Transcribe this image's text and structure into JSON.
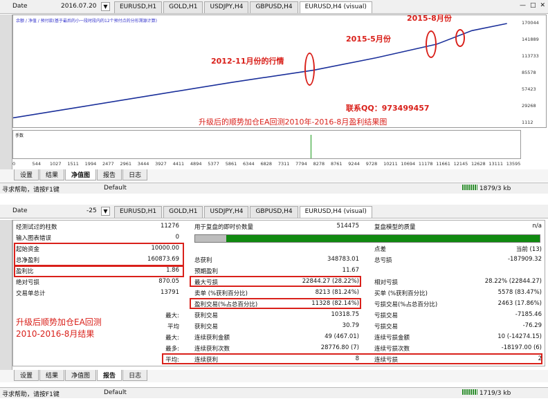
{
  "top": {
    "date_label": "Date",
    "date_value": "2016.07.20",
    "dropdown_glyph": "▼",
    "tabs": [
      "EURUSD,H1",
      "GOLD,H1",
      "USDJPY,H4",
      "GBPUSD,H4",
      "EURUSD,H4 (visual)"
    ],
    "active_tab": 4,
    "win_min": "—",
    "win_max": "□",
    "win_close": "✕"
  },
  "chart": {
    "legend": "余额 / 净值 / 预付款(基于最后的小一段时段内的12个预付点的分形溯源计算)",
    "sub_label": "手数",
    "y_ticks": [
      "170044",
      "141889",
      "113733",
      "85578",
      "57423",
      "29268",
      "1112"
    ],
    "x_ticks": [
      "0",
      "544",
      "1027",
      "1511",
      "1994",
      "2477",
      "2961",
      "3444",
      "3927",
      "4411",
      "4894",
      "5377",
      "5861",
      "6344",
      "6828",
      "7311",
      "7794",
      "8278",
      "8761",
      "9244",
      "9728",
      "10211",
      "10694",
      "11178",
      "11661",
      "12145",
      "12628",
      "13111",
      "13595"
    ],
    "annotations": {
      "a2012": "2012-11月份的行情",
      "a2015_5": "2015-5月份",
      "a2015_8": "2015-8月份",
      "qq": "联系QQ：973499457",
      "caption": "升级后的顺势加仓EA回测2010年-2016-8月盈利结果图"
    },
    "line_color": "#1a2f9a",
    "chart_data": {
      "type": "line",
      "x": [
        0,
        2000,
        4000,
        6000,
        8278,
        10000,
        11661,
        12628,
        13595
      ],
      "series": [
        {
          "values": [
            10000,
            30000,
            50000,
            70000,
            91000,
            112000,
            135000,
            158000,
            170044
          ]
        }
      ],
      "ylim": [
        1112,
        170044
      ]
    }
  },
  "bottom_tabs_1": [
    "设置",
    "结果",
    "净值图",
    "报告",
    "日志"
  ],
  "active_btab_1": 2,
  "status1": {
    "help": "寻求帮助，请按F1键",
    "profile": "Default",
    "traffic": "1879/3 kb"
  },
  "top2": {
    "date_label": "Date",
    "date_value": "-25",
    "tabs": [
      "EURUSD,H1",
      "GOLD,H1",
      "USDJPY,H4",
      "GBPUSD,H4",
      "EURUSD,H4 (visual)"
    ]
  },
  "report": {
    "r1": {
      "a": "经测试过的柱数",
      "av": "11276",
      "b": "用于复盘的即时价数量",
      "bv": "514475",
      "c": "复盘模型的质量",
      "cv": "n/a"
    },
    "r2": {
      "a": "输入图表错误",
      "av": "0"
    },
    "quality_fraction": 0.09,
    "r3": {
      "a": "起始资金",
      "av": "10000.00",
      "c": "点差",
      "cv": "当前 (13)"
    },
    "r4": {
      "a": "总净盈利",
      "av": "160873.69",
      "b": "总获利",
      "bv": "348783.01",
      "c": "总亏损",
      "cv": "-187909.32"
    },
    "r5": {
      "a": "盈利比",
      "av": "1.86",
      "b": "预期盈利",
      "bv": "11.67"
    },
    "r6": {
      "a": "绝对亏损",
      "av": "870.05",
      "b": "最大亏损",
      "bv": "22844.27 (28.22%)",
      "c": "相对亏损",
      "cv": "28.22% (22844.27)"
    },
    "r7": {
      "a": "交易单总计",
      "av": "13791",
      "b": "卖单 (%获利百分比)",
      "bv": "8213 (81.24%)",
      "c": "买单 (%获利百分比)",
      "cv": "5578 (83.47%)"
    },
    "r8": {
      "b": "盈利交易(%占总百分比)",
      "bv": "11328 (82.14%)",
      "c": "亏损交易(%占总百分比)",
      "cv": "2463 (17.86%)"
    },
    "r9": {
      "a": "最大:",
      "b": "获利交易",
      "bv": "10318.75",
      "c": "亏损交易",
      "cv": "-7185.46"
    },
    "r10": {
      "a": "平均",
      "b": "获利交易",
      "bv": "30.79",
      "c": "亏损交易",
      "cv": "-76.29"
    },
    "r11": {
      "a": "最大:",
      "b": "连续获利金额",
      "bv": "49 (467.01)",
      "c": "连续亏损金额",
      "cv": "10 (-14274.15)"
    },
    "r12": {
      "a": "最多:",
      "b": "连续获利次数",
      "bv": "28776.80 (7)",
      "c": "连续亏损次数",
      "cv": "-18197.00 (6)"
    },
    "r13": {
      "a": "平均:",
      "b": "连续获利",
      "bv": "8",
      "c": "连续亏损",
      "cv": "2"
    },
    "overlay1": "升级后顺势加仓EA回测",
    "overlay2": "2010-2016-8月结果"
  },
  "bottom_tabs_2": [
    "设置",
    "结果",
    "净值图",
    "报告",
    "日志"
  ],
  "active_btab_2": 3,
  "status2": {
    "help": "寻求帮助，请按F1键",
    "profile": "Default",
    "traffic": "1719/3 kb"
  }
}
